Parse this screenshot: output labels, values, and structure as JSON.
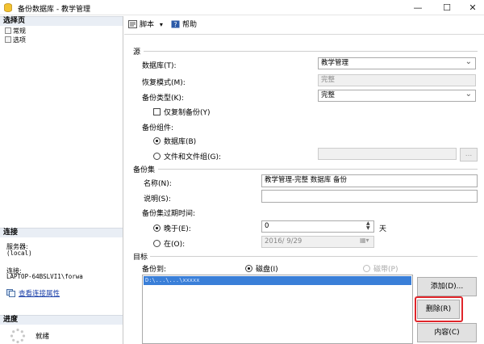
{
  "window": {
    "title": "备份数据库 - 教学管理",
    "controls": [
      "—",
      "☐",
      "✕"
    ]
  },
  "left_pane": {
    "select_page_header": "选择页",
    "pages": [
      "常规",
      "选项"
    ],
    "connection_header": "连接",
    "server_label": "服务器:",
    "server_value": "(local)",
    "connection_label": "连接:",
    "connection_value": "LAPTOP-64BSLVI1\\forwa",
    "view_props_link": "查看连接属性",
    "progress_header": "进度",
    "progress_status": "就绪"
  },
  "toolbar": {
    "script_label": "脚本",
    "help_label": "帮助"
  },
  "source": {
    "section": "源",
    "database_label": "数据库(T):",
    "database_value": "教学管理",
    "recovery_label": "恢复模式(M):",
    "recovery_value": "完整",
    "backup_type_label": "备份类型(K):",
    "backup_type_value": "完整",
    "copy_only_label": "仅复制备份(Y)",
    "component_label": "备份组件:",
    "component_db_label": "数据库(B)",
    "component_files_label": "文件和文件组(G):",
    "browse_label": "..."
  },
  "backup_set": {
    "section": "备份集",
    "name_label": "名称(N):",
    "name_value": "教学管理-完整 数据库 备份",
    "desc_label": "说明(S):",
    "desc_value": "",
    "expire_label": "备份集过期时间:",
    "after_label": "晚于(E):",
    "after_value": "0",
    "days_label": "天",
    "on_label": "在(O):",
    "on_value": "2016/ 9/29"
  },
  "destination": {
    "section": "目标",
    "backup_to_label": "备份到:",
    "disk_label": "磁盘(I)",
    "tape_label": "磁带(P)",
    "selected_path": "D:\\...\\...\\xxxxx",
    "add_button": "添加(D)...",
    "delete_button": "删除(R)",
    "contents_button": "内容(C)"
  },
  "colors": {
    "highlight": "#e0262b",
    "selection": "#3a7fd8",
    "link": "#1a3fa8"
  }
}
